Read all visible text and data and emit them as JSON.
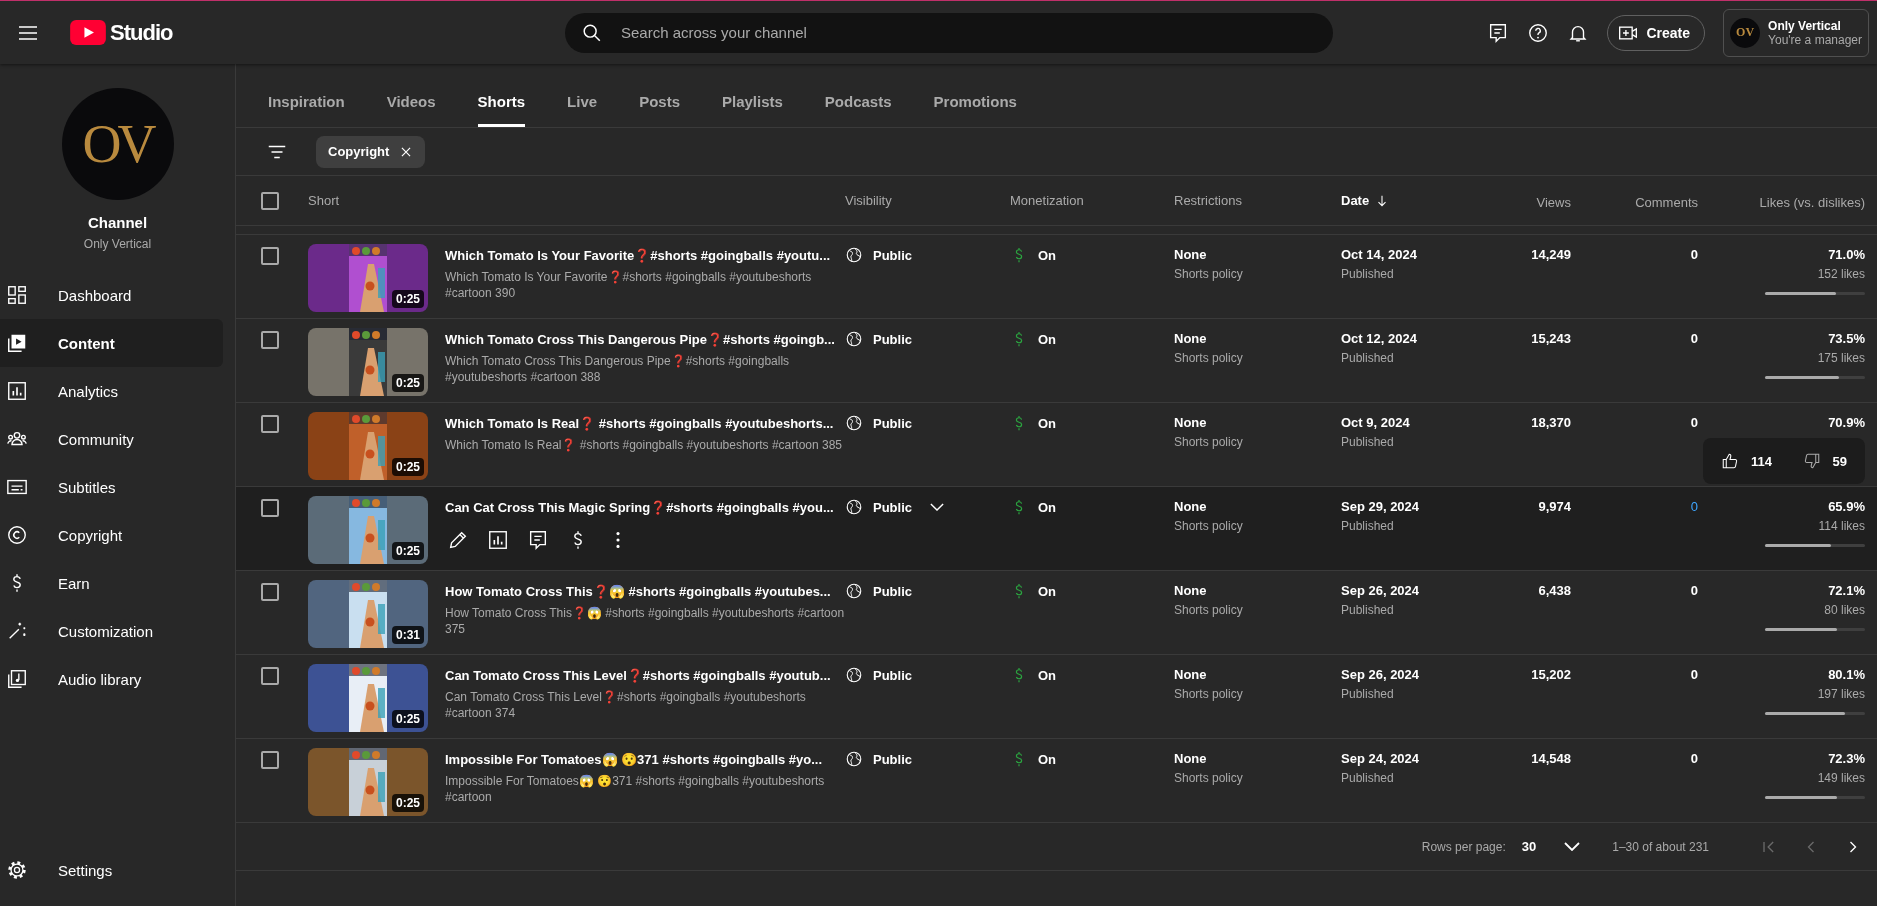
{
  "topbar": {
    "logo_text": "Studio",
    "search": {
      "placeholder": "Search across your channel"
    },
    "create_label": "Create",
    "account": {
      "avatar_text": "OV",
      "name": "Only Vertical",
      "role": "You're a manager"
    }
  },
  "sidebar": {
    "avatar_text": "OV",
    "channel_title": "Channel",
    "channel_name": "Only Vertical",
    "items": [
      {
        "label": "Dashboard",
        "kind": "dashboard",
        "selected": false
      },
      {
        "label": "Content",
        "kind": "content",
        "selected": true
      },
      {
        "label": "Analytics",
        "kind": "analytics",
        "selected": false
      },
      {
        "label": "Community",
        "kind": "community",
        "selected": false
      },
      {
        "label": "Subtitles",
        "kind": "subtitles",
        "selected": false
      },
      {
        "label": "Copyright",
        "kind": "copyright",
        "selected": false
      },
      {
        "label": "Earn",
        "kind": "earn",
        "selected": false
      },
      {
        "label": "Customization",
        "kind": "customization",
        "selected": false
      },
      {
        "label": "Audio library",
        "kind": "audio",
        "selected": false
      }
    ],
    "settings": {
      "label": "Settings"
    }
  },
  "tabs": [
    {
      "label": "Inspiration",
      "selected": false
    },
    {
      "label": "Videos",
      "selected": false
    },
    {
      "label": "Shorts",
      "selected": true
    },
    {
      "label": "Live",
      "selected": false
    },
    {
      "label": "Posts",
      "selected": false
    },
    {
      "label": "Playlists",
      "selected": false
    },
    {
      "label": "Podcasts",
      "selected": false
    },
    {
      "label": "Promotions",
      "selected": false
    }
  ],
  "filter_chips": [
    {
      "label": "Copyright"
    }
  ],
  "table": {
    "header_checked": false,
    "columns": [
      {
        "label": "Short",
        "sorted": false
      },
      {
        "label": "Visibility",
        "sorted": false
      },
      {
        "label": "Monetization",
        "sorted": false
      },
      {
        "label": "Restrictions",
        "sorted": false
      },
      {
        "label": "Date",
        "sorted": true
      },
      {
        "label": "Views",
        "sorted": false
      },
      {
        "label": "Comments",
        "sorted": false
      },
      {
        "label": "Likes (vs. dislikes)",
        "sorted": false
      }
    ],
    "rows": [
      {
        "checked": false,
        "hovered": false,
        "title": "Which Tomato Is Your Favorite❓#shorts #goingballs #youtu...",
        "description": "Which Tomato Is Your Favorite❓#shorts #goingballs #youtubeshorts #cartoon 390",
        "duration": "0:25",
        "visibility": "Public",
        "monetization": "On",
        "restriction": "None",
        "restriction_note": "Shorts policy",
        "date": "Oct 14, 2024",
        "status": "Published",
        "views": "14,249",
        "comments": "0",
        "likes_percent": "71.0%",
        "likes_count": "152 likes",
        "level": 0.71
      },
      {
        "checked": false,
        "hovered": false,
        "title": "Which Tomato Cross This Dangerous Pipe❓#shorts #goingb...",
        "description": "Which Tomato Cross This Dangerous Pipe❓#shorts #goingballs #youtubeshorts #cartoon 388",
        "duration": "0:25",
        "visibility": "Public",
        "monetization": "On",
        "restriction": "None",
        "restriction_note": "Shorts policy",
        "date": "Oct 12, 2024",
        "status": "Published",
        "views": "15,243",
        "comments": "0",
        "likes_percent": "73.5%",
        "likes_count": "175 likes",
        "level": 0.735
      },
      {
        "checked": false,
        "hovered": false,
        "title": "Which Tomato Is Real❓ #shorts #goingballs #youtubeshorts...",
        "description": "Which Tomato Is Real❓ #shorts #goingballs #youtubeshorts #cartoon 385",
        "duration": "0:25",
        "visibility": "Public",
        "monetization": "On",
        "restriction": "None",
        "restriction_note": "Shorts policy",
        "date": "Oct 9, 2024",
        "status": "Published",
        "views": "18,370",
        "comments": "0",
        "likes_percent": "70.9%",
        "likes_tooltip": {
          "likes": "114",
          "dislikes": "59"
        }
      },
      {
        "checked": false,
        "hovered": true,
        "title": "Can Cat Cross This Magic Spring❓#shorts #goingballs #you...",
        "duration": "0:25",
        "visibility": "Public",
        "monetization": "On",
        "restriction": "None",
        "restriction_note": "Shorts policy",
        "date": "Sep 29, 2024",
        "status": "Published",
        "views": "9,974",
        "comments": "0",
        "likes_percent": "65.9%",
        "likes_count": "114 likes",
        "level": 0.659
      },
      {
        "checked": false,
        "hovered": false,
        "title": "How Tomato Cross This❓😱 #shorts #goingballs #youtubes...",
        "description": "How Tomato Cross This❓😱 #shorts #goingballs #youtubeshorts #cartoon 375",
        "duration": "0:31",
        "visibility": "Public",
        "monetization": "On",
        "restriction": "None",
        "restriction_note": "Shorts policy",
        "date": "Sep 26, 2024",
        "status": "Published",
        "views": "6,438",
        "comments": "0",
        "likes_percent": "72.1%",
        "likes_count": "80 likes",
        "level": 0.721
      },
      {
        "checked": false,
        "hovered": false,
        "title": "Can Tomato Cross This Level❓#shorts #goingballs #youtub...",
        "description": "Can Tomato Cross This Level❓#shorts #goingballs #youtubeshorts #cartoon 374",
        "duration": "0:25",
        "visibility": "Public",
        "monetization": "On",
        "restriction": "None",
        "restriction_note": "Shorts policy",
        "date": "Sep 26, 2024",
        "status": "Published",
        "views": "15,202",
        "comments": "0",
        "likes_percent": "80.1%",
        "likes_count": "197 likes",
        "level": 0.801
      },
      {
        "checked": false,
        "hovered": false,
        "title": "Impossible For Tomatoes😱 😯371 #shorts #goingballs #yo...",
        "description": "Impossible For Tomatoes😱 😯371 #shorts #goingballs #youtubeshorts #cartoon",
        "duration": "0:25",
        "visibility": "Public",
        "monetization": "On",
        "restriction": "None",
        "restriction_note": "Shorts policy",
        "date": "Sep 24, 2024",
        "status": "Published",
        "views": "14,548",
        "comments": "0",
        "likes_percent": "72.3%",
        "likes_count": "149 likes",
        "level": 0.723
      }
    ]
  },
  "pagination": {
    "rows_per_page_label": "Rows per page:",
    "rows_per_page": "30",
    "range": "1–30 of about 231",
    "first_disabled": true,
    "prev_disabled": true,
    "next_disabled": false
  }
}
